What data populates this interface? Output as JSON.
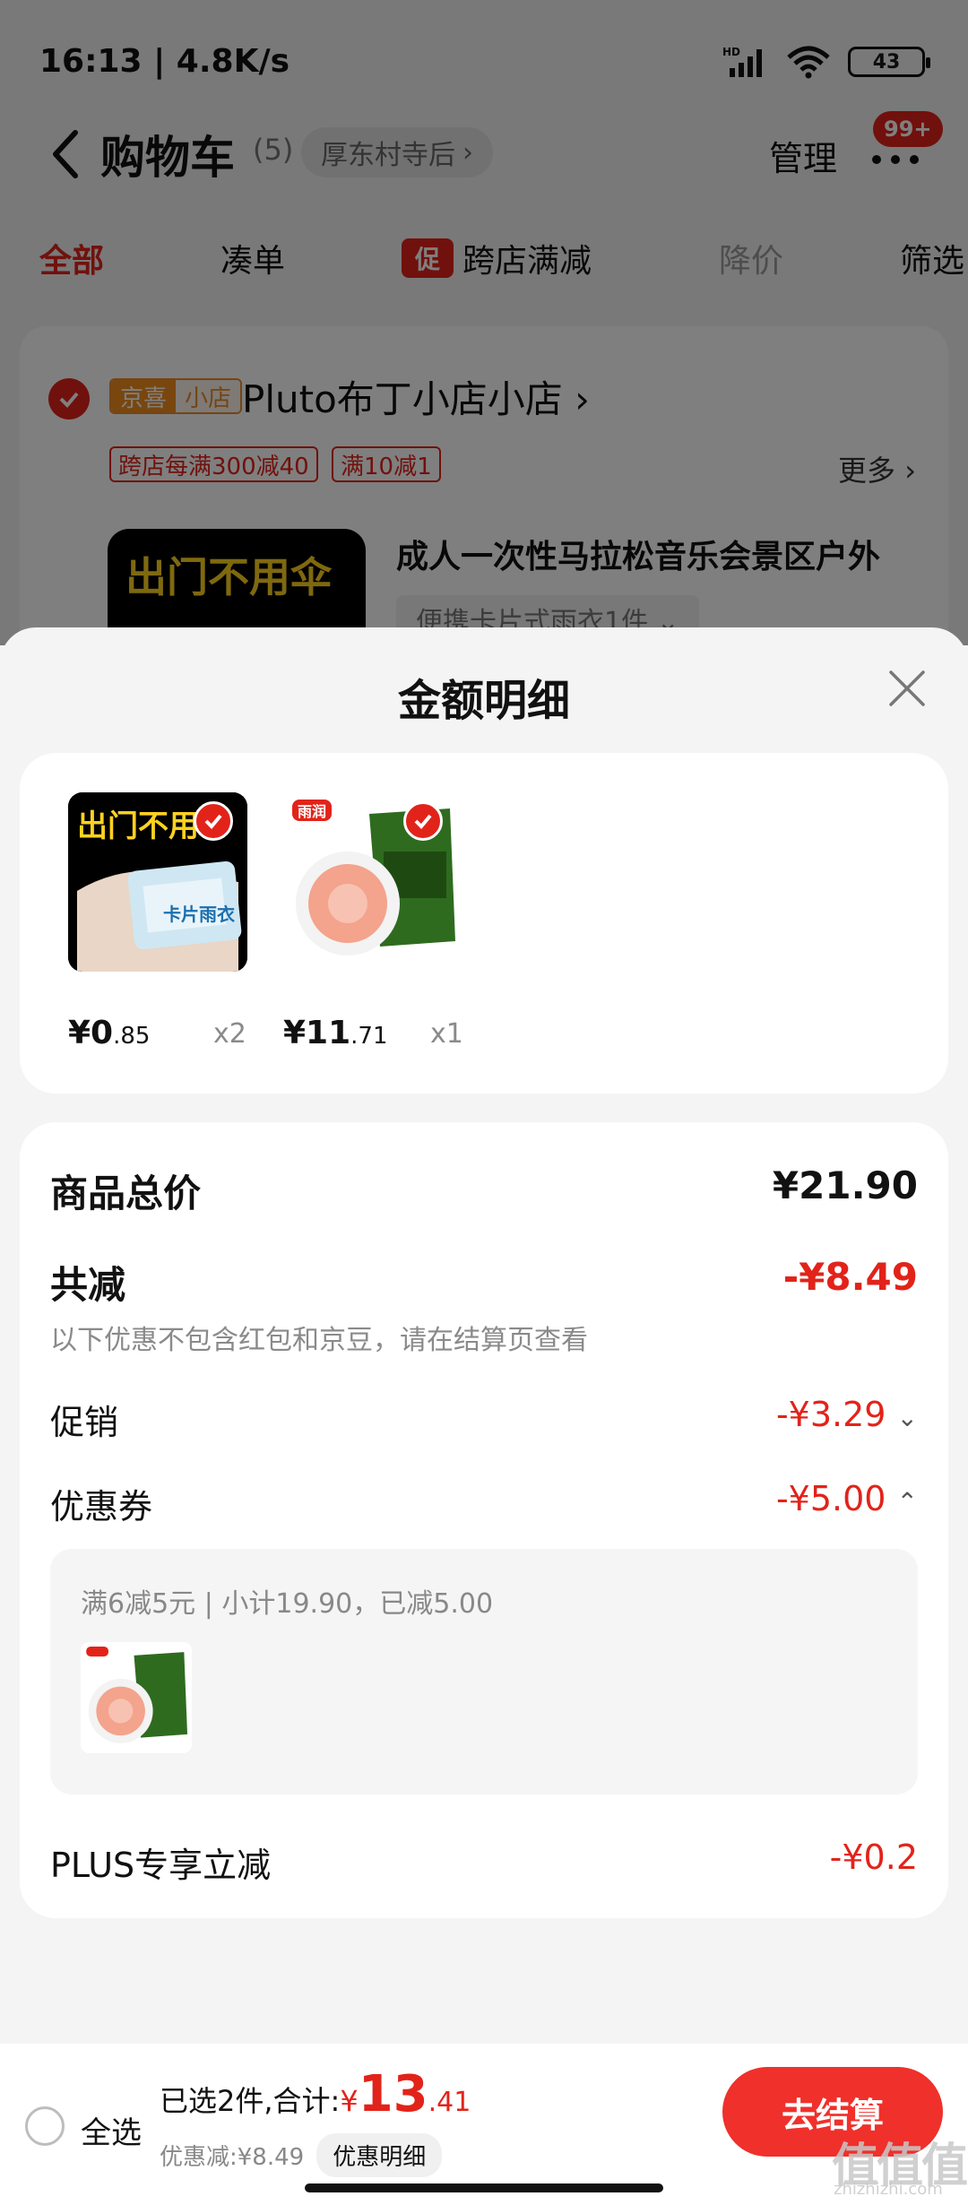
{
  "status": {
    "time": "16:13 | 4.8K/s",
    "battery": "43"
  },
  "nav": {
    "title": "购物车",
    "count": "(5)",
    "location": "厚东村寺后",
    "manage": "管理",
    "badge": "99+"
  },
  "tabs": [
    {
      "label": "全部"
    },
    {
      "label": "凑单"
    },
    {
      "label": "跨店满减",
      "tag": "促"
    },
    {
      "label": "降价"
    },
    {
      "label": "筛选"
    }
  ],
  "store": {
    "badge_a": "京喜",
    "badge_b": "小店",
    "name": "Pluto布丁小店小店 ›",
    "coupons": [
      "跨店每满300减40",
      "满10减1"
    ],
    "more": "更多 ›",
    "product_title": "成人一次性马拉松音乐会景区户外",
    "product_spec": "便携卡片式雨衣1件 ⌄",
    "thumb_text": "出门不用伞"
  },
  "sheet": {
    "title": "金额明细",
    "items": [
      {
        "price_int": "¥0",
        "price_dec": ".85",
        "qty": "x2",
        "thumb_text": "出门不用伞",
        "pack_text": "卡片雨衣"
      },
      {
        "price_int": "¥11",
        "price_dec": ".71",
        "qty": "x1",
        "brand": "雨润"
      }
    ],
    "total_label": "商品总价",
    "total_value": "¥21.90",
    "discount_label": "共减",
    "discount_value": "-¥8.49",
    "discount_note": "以下优惠不包含红包和京豆，请在结算页查看",
    "promo_label": "促销",
    "promo_value": "-¥3.29",
    "coupon_label": "优惠券",
    "coupon_value": "-¥5.00",
    "coupon_detail": "满6减5元 | 小计19.90，已减5.00",
    "plus_label": "PLUS专享立减",
    "plus_value": "-¥0.2"
  },
  "bottom": {
    "select_all": "全选",
    "summary_prefix": "已选2件,合计:",
    "sum_currency": "¥",
    "sum_int": "13",
    "sum_dec": ".41",
    "discount": "优惠减:¥8.49",
    "detail_chip": "优惠明细",
    "checkout": "去结算"
  },
  "watermark": {
    "main": "值值值",
    "sub": "zhizhizhi.com"
  },
  "colors": {
    "accent": "#e2231a",
    "button": "#f0302b",
    "background": "#f4f4f4"
  }
}
